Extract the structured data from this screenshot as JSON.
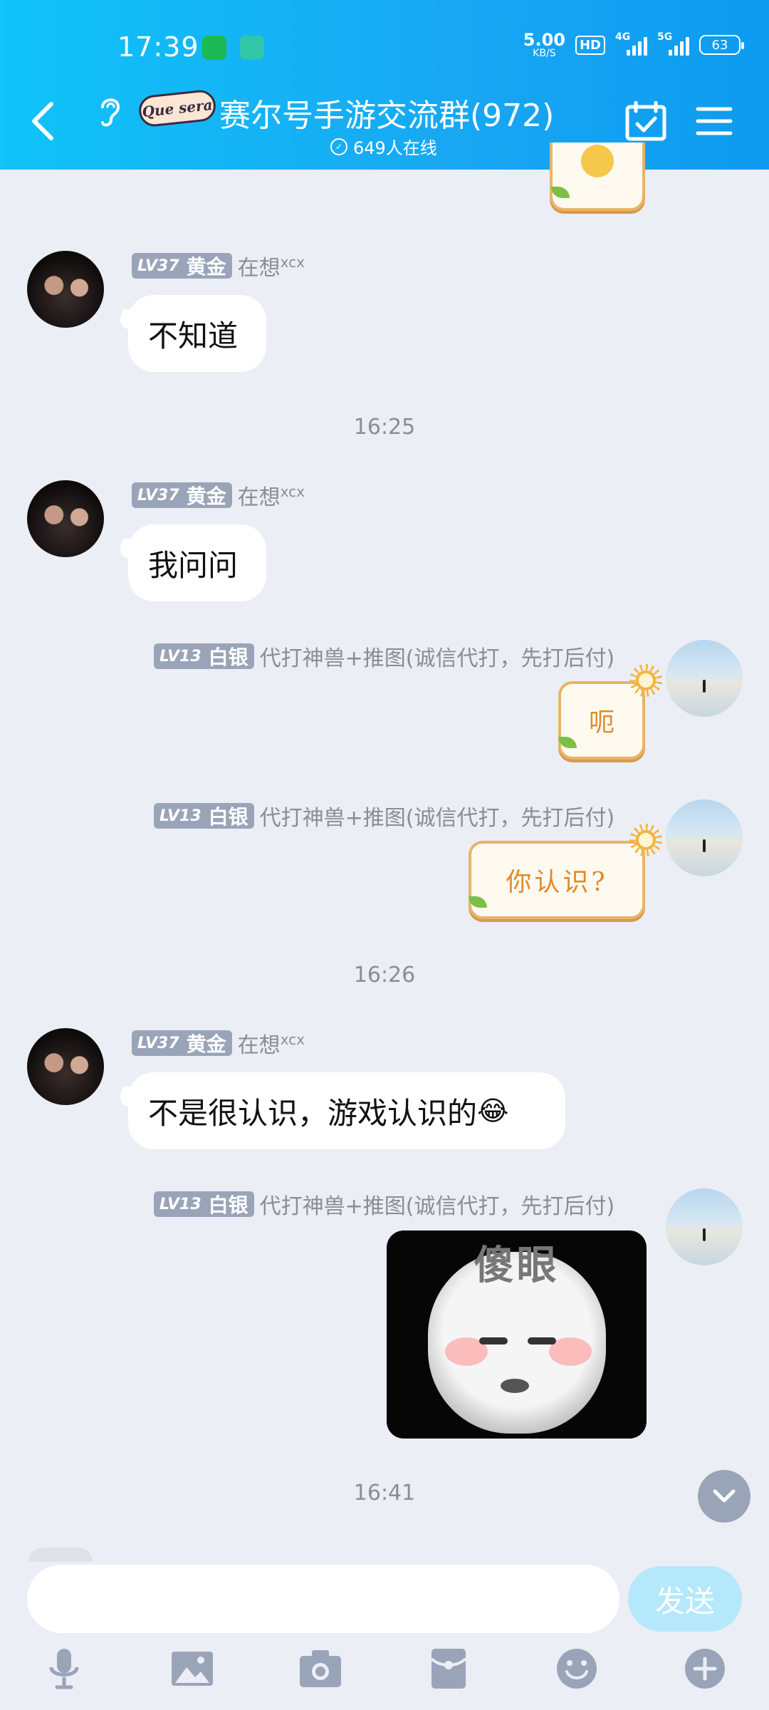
{
  "status_bar": {
    "time": "17:39",
    "net_speed_value": "5.00",
    "net_speed_unit": "KB/S",
    "hd_label": "HD",
    "sig1_label": "4G",
    "sig2_label": "5G",
    "battery": "63"
  },
  "header": {
    "logo_text": "Que sera",
    "title": "赛尔号手游交流群(972)",
    "online": "649人在线"
  },
  "timestamps": [
    "16:25",
    "16:26",
    "16:41"
  ],
  "users": {
    "gold": {
      "lv": "LV37",
      "rank": "黄金",
      "nick": "在想",
      "nick_sup": "xcx"
    },
    "silver": {
      "lv": "LV13",
      "rank": "白银",
      "nick": "代打神兽+推图(诚信代打，先打后付)"
    }
  },
  "messages": [
    {
      "text": "不知道"
    },
    {
      "text": "我问问"
    },
    {
      "sticker_text": "呃"
    },
    {
      "sticker_text": "你认识?"
    },
    {
      "text": "不是很认识，游戏认识的",
      "emoji": "😂"
    },
    {
      "sticker_text": "傻眼"
    }
  ],
  "composer": {
    "send_label": "发送",
    "placeholder": ""
  },
  "colors": {
    "header": "#10c3f8",
    "background": "#eceef5",
    "badge": "#9aa4b9",
    "send": "#b5e8fb"
  }
}
